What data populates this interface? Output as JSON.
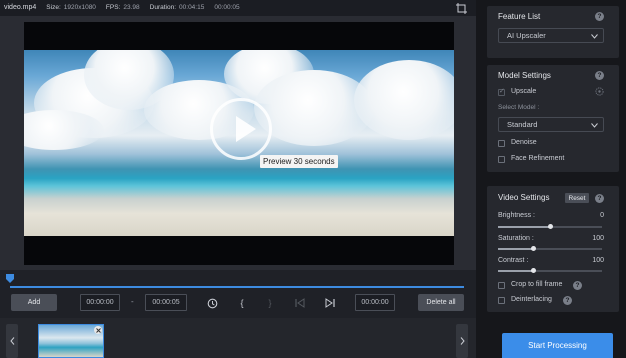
{
  "file": {
    "name": "video.mp4",
    "size_label": "Size:",
    "size": "1920x1080",
    "fps_label": "FPS:",
    "fps": "23.98",
    "duration_label": "Duration:",
    "duration": "00:04:15",
    "duration_extra": "00:00:05"
  },
  "preview": {
    "label": "Preview 30 seconds"
  },
  "controls": {
    "add": "Add",
    "start_time": "00:00:00",
    "dash": "-",
    "end_time": "00:00:05",
    "brace_open": "{",
    "brace_close": "}",
    "current_time": "00:00:00",
    "delete_all": "Delete all"
  },
  "panel": {
    "feature_list": {
      "title": "Feature List",
      "selected": "AI Upscaler"
    },
    "model_settings": {
      "title": "Model Settings",
      "upscale": "Upscale",
      "select_model_label": "Select Model :",
      "selected_model": "Standard",
      "denoise": "Denoise",
      "face_refinement": "Face Refinement"
    },
    "video_settings": {
      "title": "Video Settings",
      "reset": "Reset",
      "brightness_label": "Brightness :",
      "brightness": "0",
      "saturation_label": "Saturation :",
      "saturation": "100",
      "contrast_label": "Contrast :",
      "contrast": "100",
      "crop_to_fill": "Crop to fill frame",
      "deinterlacing": "Deinterlacing"
    },
    "start": "Start Processing"
  },
  "help_glyph": "?",
  "colors": {
    "accent": "#3b8de9",
    "panel_bg": "#16171b",
    "card_bg": "#26282e"
  }
}
